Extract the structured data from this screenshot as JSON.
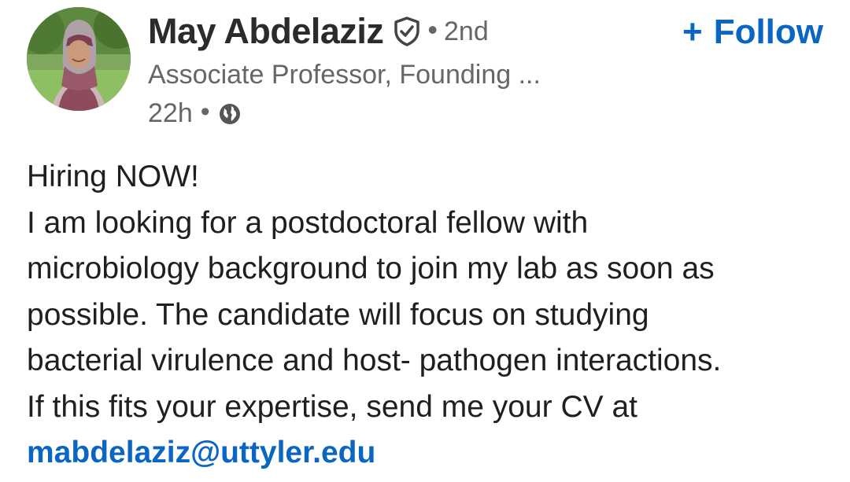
{
  "author": {
    "name": "May Abdelaziz",
    "degree": "2nd",
    "headline": "Associate Professor, Founding ...",
    "time": "22h",
    "visibility_icon": "globe-icon",
    "verified_icon": "verified-shield-icon"
  },
  "follow": {
    "plus": "+",
    "label": "Follow"
  },
  "separators": {
    "dot": "•"
  },
  "post": {
    "lines": [
      "Hiring NOW!",
      "I am looking for a postdoctoral fellow with",
      "microbiology background to join my lab as soon as",
      "possible. The candidate will focus on studying",
      "bacterial virulence and host- pathogen interactions.",
      "If this fits your expertise, send me your CV at"
    ],
    "email": "mabdelaziz@uttyler.edu"
  },
  "colors": {
    "link": "#0a66c2",
    "muted": "#666666",
    "text": "#1f1f1f"
  }
}
